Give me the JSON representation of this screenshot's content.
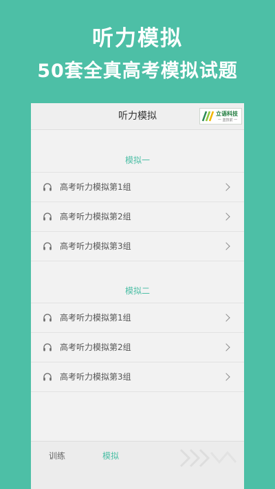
{
  "hero": {
    "title": "听力模拟",
    "subtitle": "50套全真高考模拟试题"
  },
  "header": {
    "title": "听力模拟",
    "brand": {
      "name": "立语科技",
      "tagline": "一 蓝技前 一"
    }
  },
  "sections": [
    {
      "title": "模拟一",
      "items": [
        {
          "label": "高考听力模拟第1组",
          "icon": "headphones-icon"
        },
        {
          "label": "高考听力模拟第2组",
          "icon": "headphones-icon"
        },
        {
          "label": "高考听力模拟第3组",
          "icon": "headphones-icon"
        }
      ]
    },
    {
      "title": "模拟二",
      "items": [
        {
          "label": "高考听力模拟第1组",
          "icon": "headphones-icon"
        },
        {
          "label": "高考听力模拟第2组",
          "icon": "headphones-icon"
        },
        {
          "label": "高考听力模拟第3组",
          "icon": "headphones-icon"
        }
      ]
    }
  ],
  "tabs": [
    {
      "label": "训练",
      "active": false
    },
    {
      "label": "模拟",
      "active": true
    }
  ],
  "colors": {
    "accent": "#4dbfa6",
    "background": "#f2f2f2",
    "text": "#555555"
  }
}
